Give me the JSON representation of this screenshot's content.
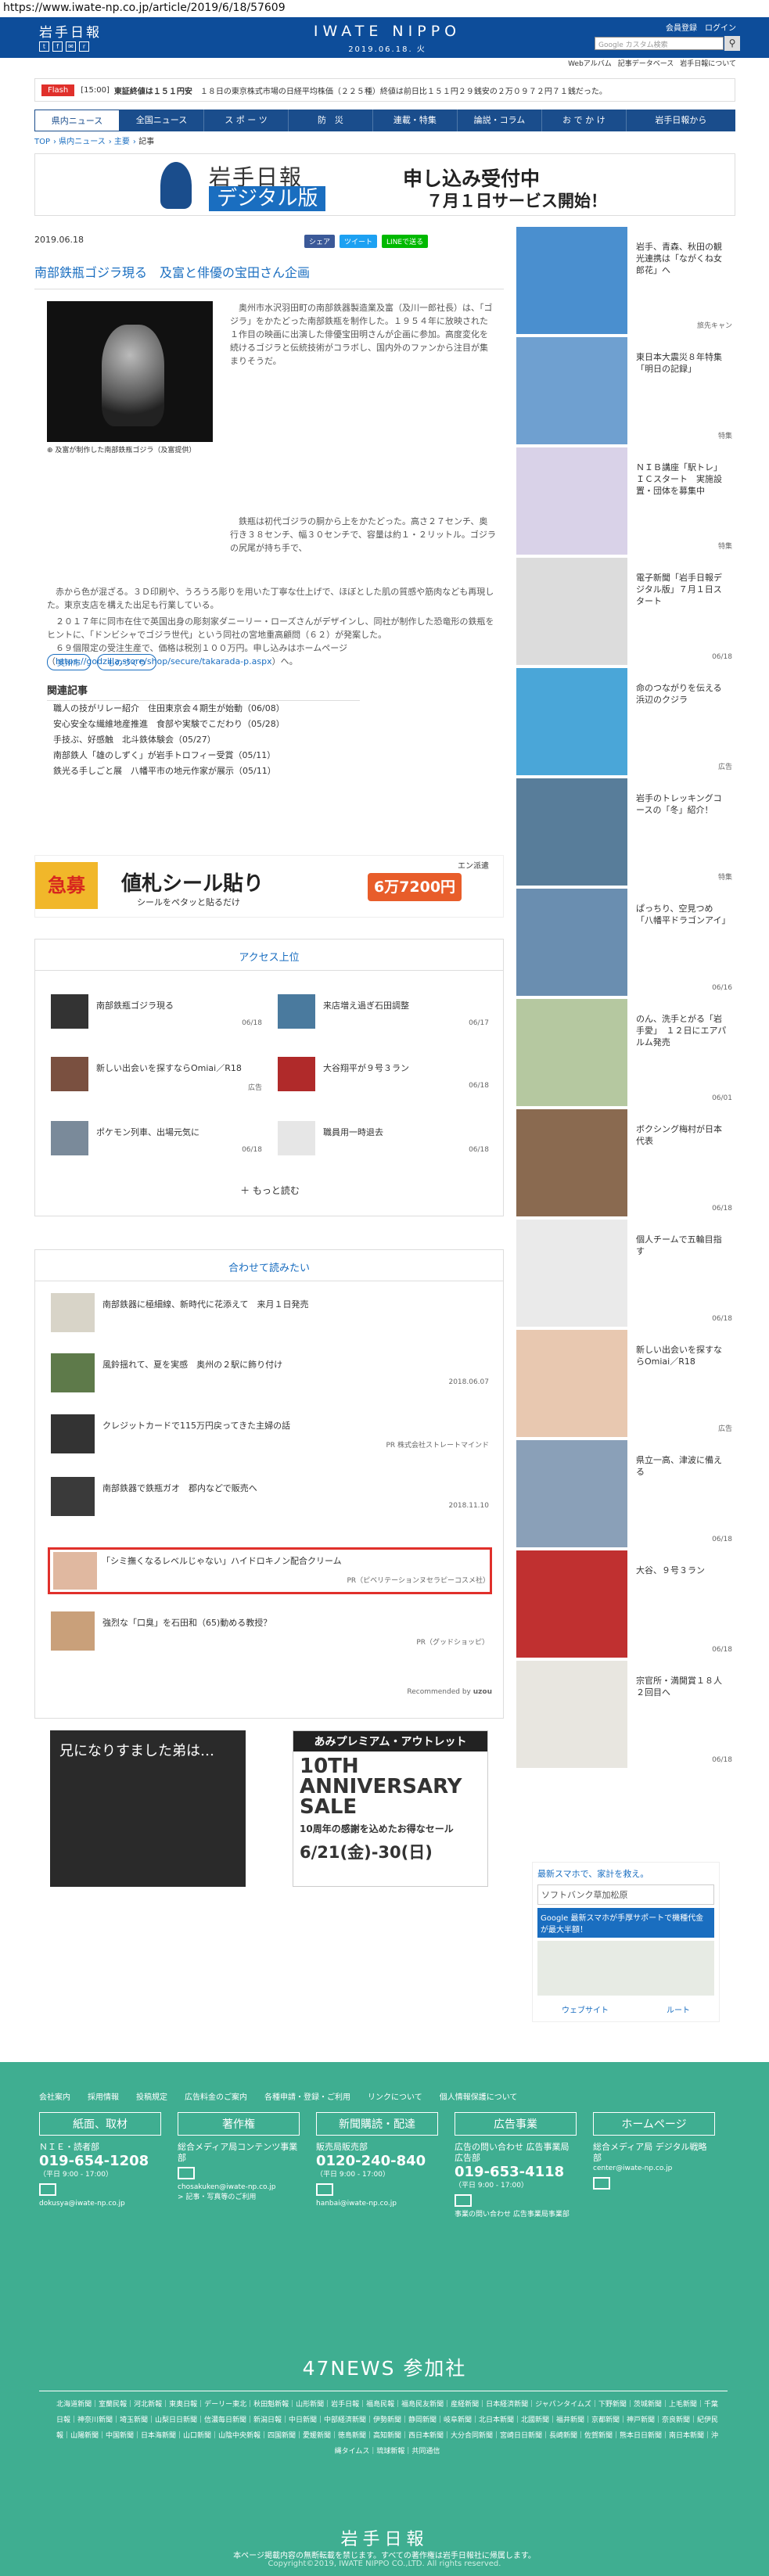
{
  "url": "https://www.iwate-np.co.jp/article/2019/6/18/57609",
  "header": {
    "logo": "岩手日報",
    "brand": "IWATE NIPPO",
    "date": "2019.06.18. 火",
    "member": "会員登録　ログイン",
    "search_placeholder": "Google カスタム検索",
    "search_icon": "magnifier-icon",
    "sub_links": [
      "Webアルバム",
      "記事データベース",
      "岩手日報について"
    ],
    "brand_color": "#0d4d9a"
  },
  "flash": {
    "tag": "Flash",
    "time": "[15:00]",
    "bold": "東証終値は１５１円安",
    "text": "１８日の東京株式市場の日経平均株価（２２５種）終値は前日比１５１円２９銭安の２万０９７２円７１銭だった。"
  },
  "nav": [
    "県内ニュース",
    "全国ニュース",
    "ス ポ ー ツ",
    "防　災",
    "連載・特集",
    "論説・コラム",
    "お で か け",
    "岩手日報から"
  ],
  "breadcrumb": [
    "TOP",
    "県内ニュース",
    "主要",
    "記事"
  ],
  "ad_top": {
    "t1": "岩手日報",
    "t2": "デジタル版",
    "t3": "申し込み受付中",
    "t4": "７月１日サービス開始！"
  },
  "article": {
    "date": "2019.06.18",
    "share": [
      "シェア",
      "ツイート",
      "LINEで送る"
    ],
    "title": "南部鉄瓶ゴジラ現る　及富と俳優の宝田さん企画",
    "caption": "及富が制作した南部鉄瓶ゴジラ（及富提供）",
    "p1": "奥州市水沢羽田町の南部鉄器製造業及富（及川一郎社長）は、「ゴジラ」をかたどった南部鉄瓶を制作した。１９５４年に放映された１作目の映画に出演した俳優宝田明さんが企画に参加。高度変化を続けるゴジラと伝統技術がコラボし、国内外のファンから注目が集まりそうだ。",
    "p2": "鉄瓶は初代ゴジラの胴から上をかたどった。高さ２７センチ、奥行き３８センチ、幅３０センチで、容量は約１・２リットル。ゴジラの尻尾が持ち手で、",
    "p3": "赤から色が混ざる。３Ｄ印刷や、うろうろ彫りを用いた丁寧な仕上げで、ほぼとした肌の質感や筋肉なども再現した。東京支店を構えた出足も行業している。",
    "p4": "２０１７年に同市在住で英国出身の彫刻家ダニーリー・ローズさんがデザインし、同社が制作した恐竜形の鉄瓶をヒントに、「ドンビシャでゴジラ世代」という同社の宮地重高顧問（６２）が発案した。",
    "p5": "６９個限定の受注生産で、価格は税別１００万円。申し込みはホームページ（",
    "link": "https://godzilla.store/shop/secure/takarada-p.aspx",
    "p5end": "）へ。",
    "tags": [
      "奥州市",
      "ものづくり"
    ],
    "related_title": "関連記事",
    "related": [
      "職人の技がリレー紹介　住田東京会４期生が始動（06/08）",
      "安心安全な繊維地産推進　食部や実験でこだわり（05/28）",
      "手技ぶ、好感触　北斗鉄体験会（05/27）",
      "南部鉄人「雄のしずく」が岩手トロフィー受賞（05/11）",
      "鉄光る手しごと展　八幡平市の地元作家が展示（05/11）"
    ]
  },
  "ad_mid": {
    "badge": "急募",
    "main": "値札シール貼り",
    "sub": "シールをペタッと貼るだけ",
    "price": "6万7200円",
    "corner": "エン派遣"
  },
  "ranking": {
    "title": "アクセス上位",
    "items": [
      {
        "title": "南部鉄瓶ゴジラ現る",
        "date": "06/18"
      },
      {
        "title": "来店増え過ぎ石田調整",
        "date": "06/17"
      },
      {
        "title": "新しい出会いを探すならOmiai／R18",
        "date": "広告"
      },
      {
        "title": "大谷翔平が９号３ラン",
        "date": "06/18"
      },
      {
        "title": "ポケモン列車、出場元気に",
        "date": "06/18"
      },
      {
        "title": "職員用一時退去",
        "date": "06/18"
      }
    ],
    "more": "もっと読む"
  },
  "together": {
    "title": "合わせて読みたい",
    "items": [
      {
        "title": "南部鉄器に極細線、新時代に花添えて　来月１日発売",
        "sponsor": ""
      },
      {
        "title": "風鈴揺れて、夏を実感　奥州の２駅に飾り付け",
        "sponsor": "2018.06.07"
      },
      {
        "title": "クレジットカードで115万円戻ってきた主婦の話",
        "sponsor": "PR 株式会社ストレートマインド"
      },
      {
        "title": "南部鉄器で鉄瓶ガオ　郡内などで販売へ",
        "sponsor": "2018.11.10"
      },
      {
        "title": "「シミ撫くなるレベルじゃない」ハイドロキノン配合クリーム",
        "sponsor": "PR（ピベリテーションヌセラピーコスメ社）"
      },
      {
        "title": "強烈な「口臭」を石田和（65)動める教授？",
        "sponsor": "PR（グッドショッピ）"
      }
    ],
    "recommend": "Recommended by"
  },
  "bottom_ads": {
    "a": "兄になりすました弟は…",
    "b_head": "あみプレミアム・アウトレット",
    "b_big": "10TH ANNIVERSARY SALE",
    "b_sub": "10周年の感謝を込めたお得なセール",
    "b_date": "6/21(金)-30(日)"
  },
  "side": [
    {
      "text": "岩手、青森、秋田の観光連携は「ながくね女郎花」へ",
      "tag": "旅先キャン"
    },
    {
      "text": "東日本大震災８年特集「明日の記録」",
      "tag": "特集"
    },
    {
      "text": "ＮＩＢ講座「駅トレ」ＩＣスタート　実施設置・団体を募集中",
      "tag": "特集"
    },
    {
      "text": "電子新聞「岩手日報デジタル版」７月１日スタート",
      "tag": "06/18"
    },
    {
      "text": "命のつながりを伝える浜辺のクジラ",
      "tag": "広告"
    },
    {
      "text": "岩手のトレッキングコースの「冬」紹介！",
      "tag": "特集"
    },
    {
      "text": "ぱっちり、空見つめ「八幡平ドラゴンアイ」",
      "tag": "06/16"
    },
    {
      "text": "のん、洗手とがる「岩手愛」　１２日にエアパルム発売",
      "tag": "06/01"
    },
    {
      "text": "ボクシング梅村が日本代表",
      "tag": "06/18"
    },
    {
      "text": "個人チームで五輪目指す",
      "tag": "06/18"
    },
    {
      "text": "新しい出会いを探すならOmiai／R18",
      "tag": "広告"
    },
    {
      "text": "県立一高、津波に備える",
      "tag": "06/18"
    },
    {
      "text": "大谷、９号３ラン",
      "tag": "06/18"
    },
    {
      "text": "宗官所・満開賞１８人２回目へ",
      "tag": "06/18"
    }
  ],
  "map_ad": {
    "l1": "最新スマホで、家計を救え。",
    "l2": "ソフトバンク草加松原",
    "l3": "Google 最新スマホが手厚サポートで機種代金が最大半額！",
    "b1": "ウェブサイト",
    "b2": "ルート"
  },
  "footer": {
    "top": [
      "会社案内",
      "採用情報",
      "投稿規定",
      "広告料金のご案内",
      "各種申請・登録・ご利用",
      "リンクについて",
      "個人情報保護について"
    ],
    "cols": [
      {
        "h": "紙面、取材",
        "l": "ＮＩＥ・読者部",
        "tel": "019-654-1208",
        "s": "（平日 9:00 - 17:00）",
        "mail": "dokusya@iwate-np.co.jp"
      },
      {
        "h": "著作権",
        "l": "総合メディア局コンテンツ事業部",
        "tel": "",
        "s": "chosakuken@iwate-np.co.jp",
        "mail": "> 記事・写真等のご利用"
      },
      {
        "h": "新聞購読・配達",
        "l": "販売局販売部",
        "tel": "0120-240-840",
        "s": "（平日 9:00 - 17:00）",
        "mail": "hanbai@iwate-np.co.jp"
      },
      {
        "h": "広告事業",
        "l": "広告の問い合わせ 広告事業局広告部",
        "tel": "019-653-4118",
        "s": "（平日 9:00 - 17:00）",
        "mail": "事業の問い合わせ 広告事業局事業部"
      },
      {
        "h": "ホームページ",
        "l": "総合メディア局 デジタル戦略部",
        "tel": "",
        "s": "center@iwate-np.co.jp",
        "mail": ""
      }
    ],
    "n47": "47NEWS 参加社",
    "papers": "北海道新聞｜室蘭民報｜河北新報｜東奥日報｜デーリー東北｜秋田魁新報｜山形新聞｜岩手日報｜福島民報｜福島民友新聞｜産経新聞｜日本経済新聞｜ジャパンタイムズ｜下野新聞｜茨城新聞｜上毛新聞｜千葉日報｜神奈川新聞｜埼玉新聞｜山梨日日新聞｜信濃毎日新聞｜新潟日報｜中日新聞｜中部経済新聞｜伊勢新聞｜静岡新聞｜岐阜新聞｜北日本新聞｜北國新聞｜福井新聞｜京都新聞｜神戸新聞｜奈良新聞｜紀伊民報｜山陽新聞｜中国新聞｜日本海新聞｜山口新聞｜山陰中央新報｜四国新聞｜愛媛新聞｜徳島新聞｜高知新聞｜西日本新聞｜大分合同新聞｜宮崎日日新聞｜長崎新聞｜佐賀新聞｜熊本日日新聞｜南日本新聞｜沖縄タイムス｜琉球新報｜共同通信",
    "logo": "岩手日報",
    "notice": "本ページ掲載内容の無断転載を禁じます。すべての著作権は岩手日報社に帰属します。",
    "copy": "Copyright©2019, IWATE NIPPO CO.,LTD. All rights reserved.",
    "color": "#3fae91"
  }
}
